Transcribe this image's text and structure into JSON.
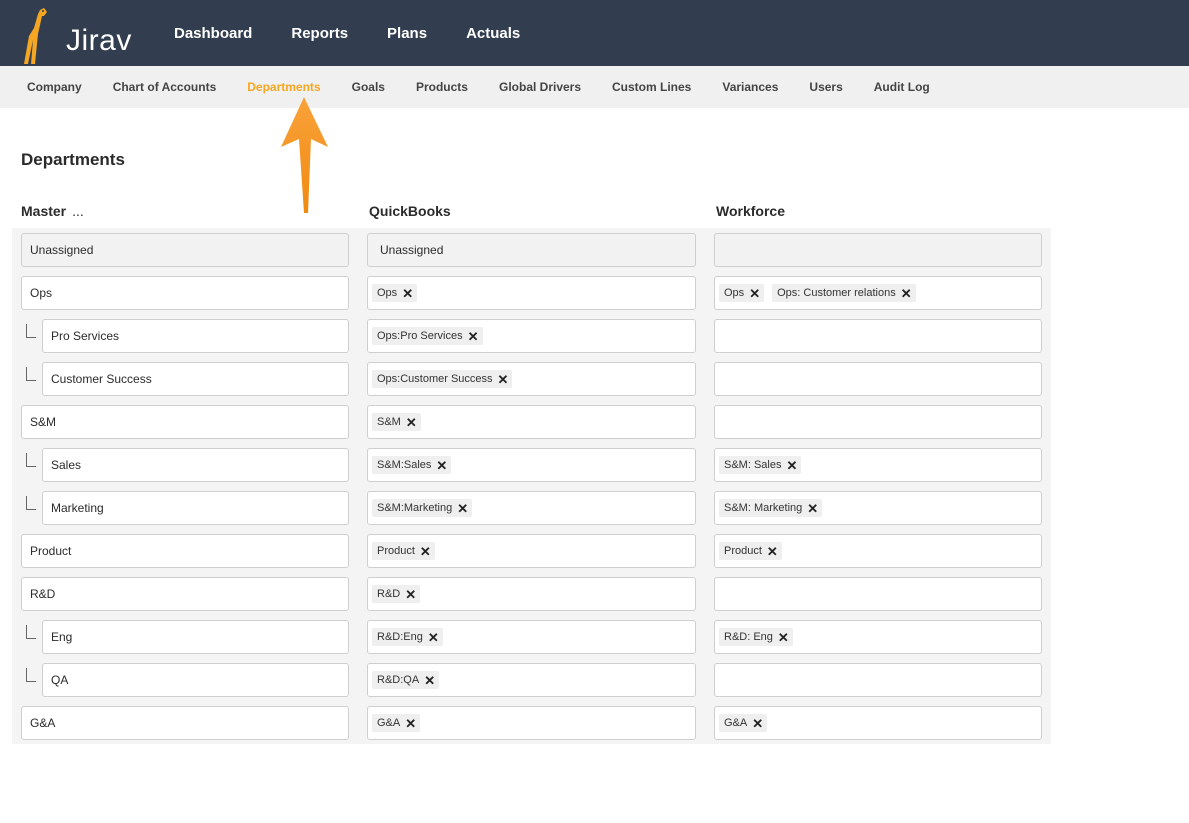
{
  "app": {
    "logo_text": "Jirav"
  },
  "topnav": [
    "Dashboard",
    "Reports",
    "Plans",
    "Actuals"
  ],
  "subnav": {
    "items": [
      "Company",
      "Chart of Accounts",
      "Departments",
      "Goals",
      "Products",
      "Global Drivers",
      "Custom Lines",
      "Variances",
      "Users",
      "Audit Log"
    ],
    "active": "Departments"
  },
  "page_title": "Departments",
  "columns": {
    "master": "Master",
    "master_more": "...",
    "quickbooks": "QuickBooks",
    "workforce": "Workforce"
  },
  "colors": {
    "header_bg": "#323e4f",
    "active_tab": "#f5a623",
    "arrow": "#f7961e"
  },
  "rows": [
    {
      "master": "Unassigned",
      "child": false,
      "disabled": true,
      "qb_text": "Unassigned",
      "qb": [],
      "wf": []
    },
    {
      "master": "Ops",
      "child": false,
      "qb": [
        "Ops"
      ],
      "wf": [
        "Ops",
        "Ops: Customer relations"
      ]
    },
    {
      "master": "Pro Services",
      "child": true,
      "qb": [
        "Ops:Pro Services"
      ],
      "wf": []
    },
    {
      "master": "Customer Success",
      "child": true,
      "qb": [
        "Ops:Customer Success"
      ],
      "wf": []
    },
    {
      "master": "S&M",
      "child": false,
      "qb": [
        "S&M"
      ],
      "wf": []
    },
    {
      "master": "Sales",
      "child": true,
      "qb": [
        "S&M:Sales"
      ],
      "wf": [
        "S&M: Sales"
      ]
    },
    {
      "master": "Marketing",
      "child": true,
      "qb": [
        "S&M:Marketing"
      ],
      "wf": [
        "S&M: Marketing"
      ]
    },
    {
      "master": "Product",
      "child": false,
      "qb": [
        "Product"
      ],
      "wf": [
        "Product"
      ]
    },
    {
      "master": "R&D",
      "child": false,
      "qb": [
        "R&D"
      ],
      "wf": []
    },
    {
      "master": "Eng",
      "child": true,
      "qb": [
        "R&D:Eng"
      ],
      "wf": [
        "R&D: Eng"
      ]
    },
    {
      "master": "QA",
      "child": true,
      "qb": [
        "R&D:QA"
      ],
      "wf": []
    },
    {
      "master": "G&A",
      "child": false,
      "qb": [
        "G&A"
      ],
      "wf": [
        "G&A"
      ]
    }
  ]
}
